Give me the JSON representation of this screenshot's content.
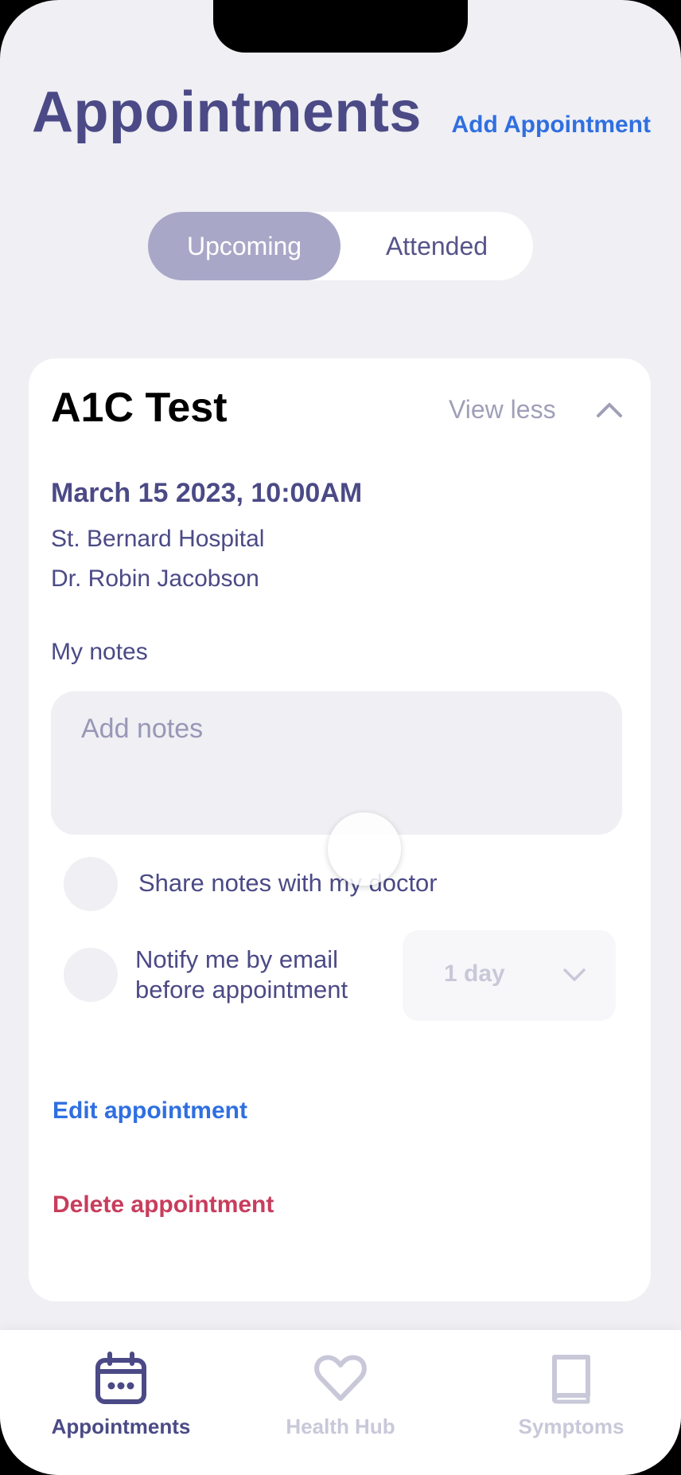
{
  "header": {
    "title": "Appointments",
    "add_label": "Add Appointment"
  },
  "segments": {
    "upcoming": "Upcoming",
    "attended": "Attended",
    "selected": "Upcoming"
  },
  "appointment": {
    "title": "A1C Test",
    "view_less": "View less",
    "datetime": "March 15 2023, 10:00AM",
    "location": "St. Bernard Hospital",
    "doctor": "Dr. Robin Jacobson",
    "notes_label": "My notes",
    "notes_placeholder": "Add notes",
    "share_label": "Share notes with my doctor",
    "notify_line1": "Notify me by email",
    "notify_line2": "before appointment",
    "notify_lead_time": "1 day",
    "edit_label": "Edit appointment",
    "delete_label": "Delete appointment"
  },
  "tabbar": {
    "items": [
      {
        "label": "Appointments",
        "icon": "calendar-icon",
        "active": true
      },
      {
        "label": "Health Hub",
        "icon": "heart-icon",
        "active": false
      },
      {
        "label": "Symptoms",
        "icon": "book-icon",
        "active": false
      }
    ]
  },
  "colors": {
    "primary": "#4b4a86",
    "link_blue": "#2f6fe0",
    "danger": "#c83d5c",
    "segment_active": "#a8a7c7",
    "background": "#efeff4"
  }
}
